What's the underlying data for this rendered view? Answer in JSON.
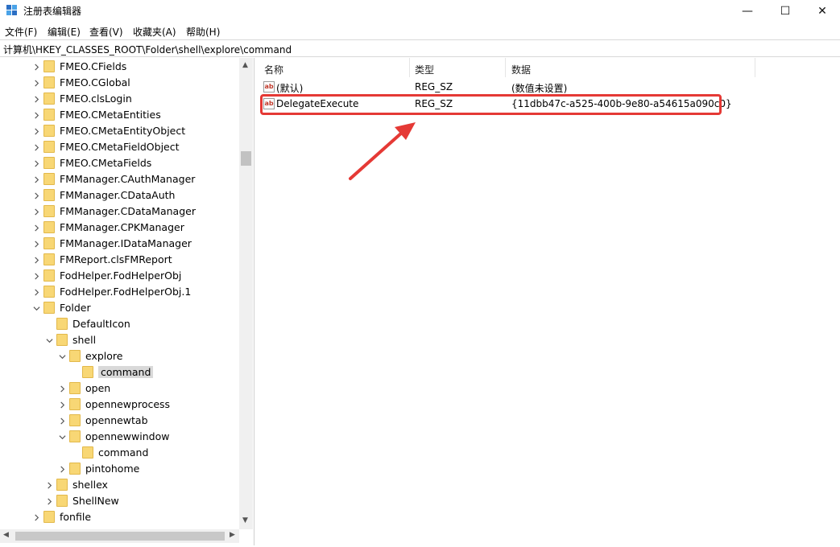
{
  "window": {
    "title": "注册表编辑器",
    "controls": {
      "minimize": "—",
      "maximize": "☐",
      "close": "✕"
    }
  },
  "menu": [
    "文件(F)",
    "编辑(E)",
    "查看(V)",
    "收藏夹(A)",
    "帮助(H)"
  ],
  "address": "计算机\\HKEY_CLASSES_ROOT\\Folder\\shell\\explore\\command",
  "tree": {
    "items": [
      {
        "label": "FMEO.CFields",
        "expand": ">"
      },
      {
        "label": "FMEO.CGlobal",
        "expand": ">"
      },
      {
        "label": "FMEO.clsLogin",
        "expand": ">"
      },
      {
        "label": "FMEO.CMetaEntities",
        "expand": ">"
      },
      {
        "label": "FMEO.CMetaEntityObject",
        "expand": ">"
      },
      {
        "label": "FMEO.CMetaFieldObject",
        "expand": ">"
      },
      {
        "label": "FMEO.CMetaFields",
        "expand": ">"
      },
      {
        "label": "FMManager.CAuthManager",
        "expand": ">"
      },
      {
        "label": "FMManager.CDataAuth",
        "expand": ">"
      },
      {
        "label": "FMManager.CDataManager",
        "expand": ">"
      },
      {
        "label": "FMManager.CPKManager",
        "expand": ">"
      },
      {
        "label": "FMManager.IDataManager",
        "expand": ">"
      },
      {
        "label": "FMReport.clsFMReport",
        "expand": ">"
      },
      {
        "label": "FodHelper.FodHelperObj",
        "expand": ">"
      },
      {
        "label": "FodHelper.FodHelperObj.1",
        "expand": ">"
      },
      {
        "label": "Folder",
        "expand": "v"
      },
      {
        "label": "DefaultIcon",
        "expand": ""
      },
      {
        "label": "shell",
        "expand": "v"
      },
      {
        "label": "explore",
        "expand": "v"
      },
      {
        "label": "command",
        "expand": "",
        "selected": true
      },
      {
        "label": "open",
        "expand": ">"
      },
      {
        "label": "opennewprocess",
        "expand": ">"
      },
      {
        "label": "opennewtab",
        "expand": ">"
      },
      {
        "label": "opennewwindow",
        "expand": "v"
      },
      {
        "label": "command",
        "expand": ""
      },
      {
        "label": "pintohome",
        "expand": ">"
      },
      {
        "label": "shellex",
        "expand": ">"
      },
      {
        "label": "ShellNew",
        "expand": ">"
      },
      {
        "label": "fonfile",
        "expand": ">"
      }
    ]
  },
  "values": {
    "columns": {
      "name": "名称",
      "type": "类型",
      "data": "数据"
    },
    "rows": [
      {
        "icon": "ab",
        "name": "(默认)",
        "type": "REG_SZ",
        "data": "(数值未设置)"
      },
      {
        "icon": "ab",
        "name": "DelegateExecute",
        "type": "REG_SZ",
        "data": "{11dbb47c-a525-400b-9e80-a54615a090c0}"
      }
    ]
  },
  "annotation": {
    "highlight_color": "#e53935"
  },
  "colors": {
    "folder": "#f8d775",
    "selection": "#d9d9d9",
    "accent_red": "#e53935"
  }
}
